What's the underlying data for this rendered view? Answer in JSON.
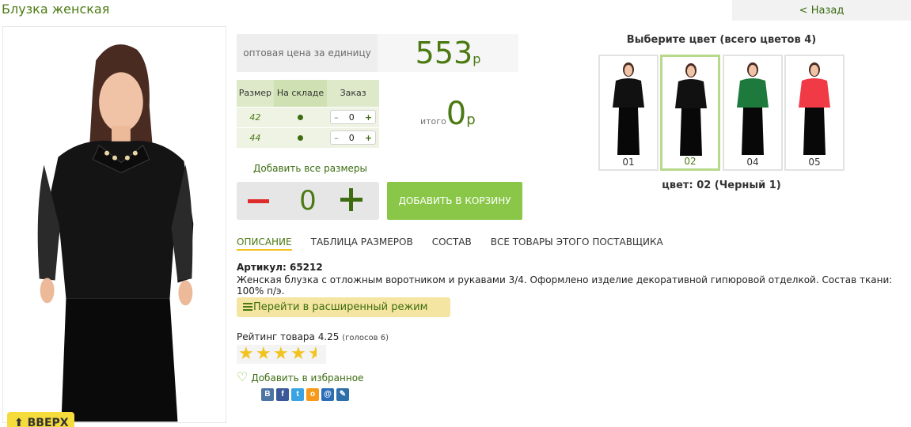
{
  "product": {
    "title": "Блузка женская",
    "back_label": "< Назад",
    "up_label": "⬆ ВВЕРХ"
  },
  "price": {
    "label": "оптовая цена за единицу",
    "value": "553",
    "currency": "р"
  },
  "sizes": {
    "headers": [
      "Размер",
      "На складе",
      "Заказ"
    ],
    "rows": [
      {
        "size": "42",
        "in_stock": true,
        "qty": "0"
      },
      {
        "size": "44",
        "in_stock": true,
        "qty": "0"
      }
    ],
    "stepper_minus": "–",
    "stepper_plus": "+"
  },
  "total": {
    "label": "итого",
    "value": "0",
    "currency": "р"
  },
  "add_all_sizes": "Добавить все размеры",
  "quantity": "0",
  "cart_button": "ДОБАВИТЬ В КОРЗИНУ",
  "colors": {
    "title": "Выберите цвет (всего цветов 4)",
    "items": [
      {
        "code": "01",
        "color": "#111111",
        "active": false
      },
      {
        "code": "02",
        "color": "#111111",
        "active": true
      },
      {
        "code": "04",
        "color": "#1e7a3c",
        "active": false
      },
      {
        "code": "05",
        "color": "#f03a46",
        "active": false
      }
    ],
    "selected_label": "цвет: 02 (Черный 1)"
  },
  "tabs": [
    "ОПИСАНИЕ",
    "ТАБЛИЦА РАЗМЕРОВ",
    "СОСТАВ",
    "ВСЕ ТОВАРЫ ЭТОГО ПОСТАВЩИКА"
  ],
  "article": "Артикул: 65212",
  "description": "Женская блузка с отложным воротником и рукавами 3/4. Оформлено изделие декоративной гипюровой отделкой. Состав ткани: 100% п/э.",
  "advanced_mode": "Перейти в расширенный режим",
  "rating": {
    "label": "Рейтинг товара 4.25",
    "votes": "(голосов 6)",
    "value": 4.25,
    "max": 5
  },
  "favorite": "Добавить в избранное",
  "social": [
    {
      "name": "vkontakte-icon",
      "glyph": "В",
      "color": "#4c75a3"
    },
    {
      "name": "facebook-icon",
      "glyph": "f",
      "color": "#3b5998"
    },
    {
      "name": "twitter-icon",
      "glyph": "t",
      "color": "#3aa3e3"
    },
    {
      "name": "odnoklassniki-icon",
      "glyph": "о",
      "color": "#f59a1b"
    },
    {
      "name": "mail-icon",
      "glyph": "@",
      "color": "#2c6db8"
    },
    {
      "name": "livejournal-icon",
      "glyph": "✎",
      "color": "#2d6fa8"
    }
  ],
  "colors_theme": {
    "brand_green": "#4b7a12",
    "button_green": "#8ac748",
    "yellow": "#f2c31f"
  }
}
